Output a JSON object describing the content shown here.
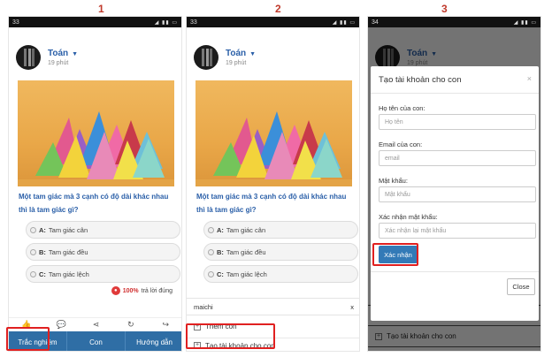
{
  "steps": [
    "1",
    "2",
    "3"
  ],
  "status_time": [
    "33",
    "33",
    "34"
  ],
  "post": {
    "author": "Toán",
    "time_ago": "19 phút",
    "question": "Một tam giác mà 3 cạnh có độ dài khác nhau thì là tam giác gì?",
    "options": [
      {
        "key": "A:",
        "text": "Tam giác cân"
      },
      {
        "key": "B:",
        "text": "Tam giác đều"
      },
      {
        "key": "C:",
        "text": "Tam giác lệch"
      }
    ],
    "correct_percent": "100%",
    "correct_text": "trả lời đúng"
  },
  "actions": [
    "like-icon",
    "comment-icon",
    "share-icon",
    "repost-icon",
    "forward-icon"
  ],
  "bottom_tabs": [
    "Trắc nghiệm",
    "Con",
    "Hướng dẫn"
  ],
  "panel": {
    "input_value": "maichi",
    "close": "x",
    "items": [
      "Thêm con",
      "Tạo tài khoản cho con"
    ]
  },
  "modal": {
    "title": "Tạo tài khoản cho con",
    "close_x": "×",
    "fields": [
      {
        "label": "Họ tên của con:",
        "placeholder": "Họ tên"
      },
      {
        "label": "Email của con:",
        "placeholder": "email"
      },
      {
        "label": "Mật khẩu:",
        "placeholder": "Mật khẩu"
      },
      {
        "label": "Xác nhận mật khẩu:",
        "placeholder": "Xác nhận lại mật khẩu"
      }
    ],
    "submit": "Xác nhận",
    "close_button": "Close"
  },
  "colors": {
    "accent": "#2f6ea5",
    "link": "#2a5fa8",
    "highlight": "#e02020",
    "primary": "#337ab7"
  }
}
